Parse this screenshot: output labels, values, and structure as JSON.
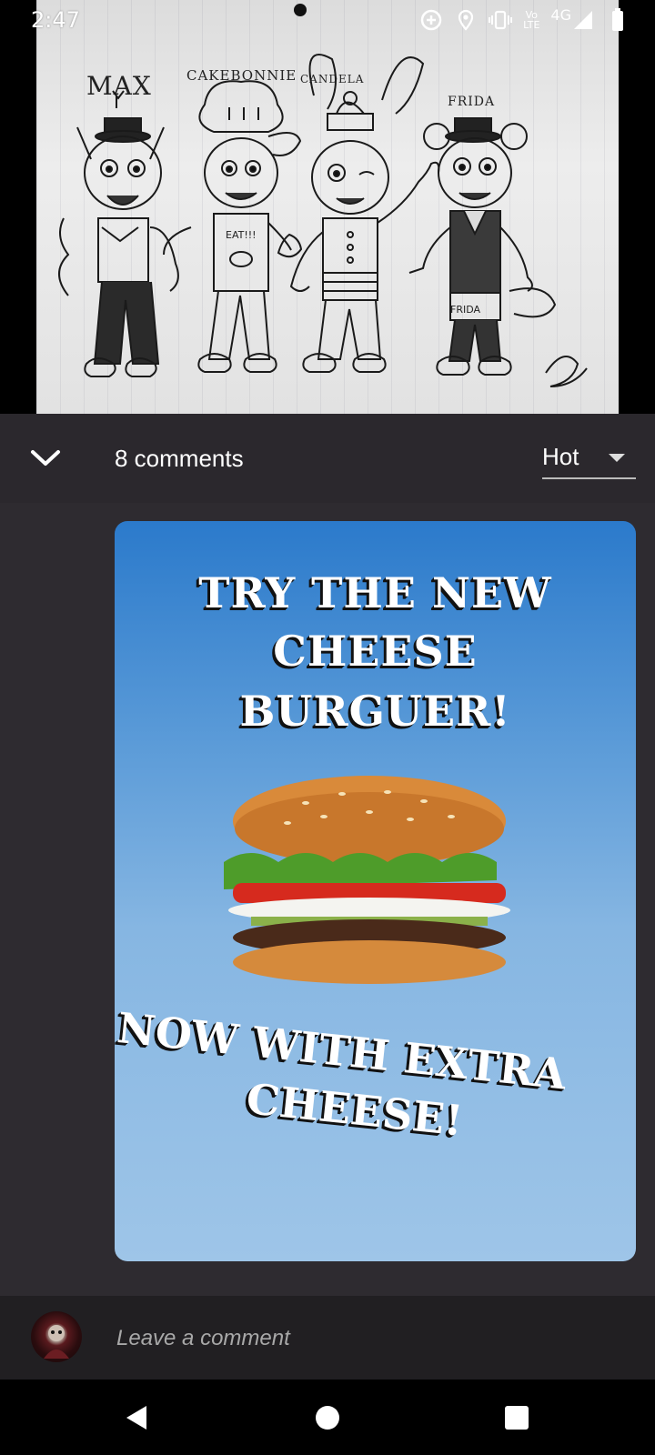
{
  "status": {
    "time": "2:47",
    "volte_top": "Vo",
    "volte_bottom": "LTE",
    "network": "4G"
  },
  "drawing": {
    "labels": [
      "MAX",
      "CAKEBONNIE",
      "CANDELA",
      "FRIDA"
    ],
    "shirt_text": "EAT!!!",
    "legs_text": "FRIDA"
  },
  "comments": {
    "count_label": "8 comments",
    "sort_value": "Hot"
  },
  "ad": {
    "headline_lines": [
      "TRY THE NEW",
      "CHEESE",
      "BURGUER!"
    ],
    "sub_lines": [
      "NOW WITH EXTRA",
      "CHEESE!"
    ]
  },
  "comment_bar": {
    "placeholder": "Leave a comment"
  },
  "icons": {
    "collapse": "chevron-down-icon",
    "sort": "dropdown-arrow-icon",
    "back": "back-triangle-icon",
    "home": "home-circle-icon",
    "recents": "recents-square-icon"
  }
}
